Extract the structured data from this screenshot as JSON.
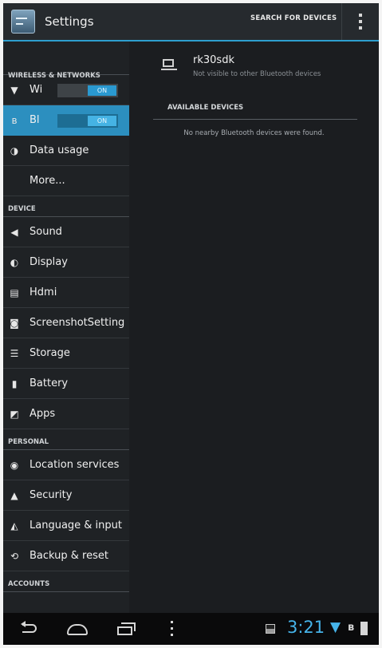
{
  "action_bar": {
    "title": "Settings",
    "search_label": "SEARCH FOR DEVICES"
  },
  "sidebar": {
    "sections": [
      "WIRELESS & NETWORKS",
      "DEVICE",
      "PERSONAL",
      "ACCOUNTS"
    ],
    "wifi": {
      "label": "Wi",
      "toggle": "ON",
      "icon": "wifi-icon"
    },
    "bluetooth": {
      "label": "Bl",
      "toggle": "ON",
      "icon": "bluetooth-icon"
    },
    "items": [
      {
        "label": "Data usage",
        "icon": "data-usage-icon"
      },
      {
        "label": "More...",
        "icon": ""
      },
      {
        "label": "Sound",
        "icon": "speaker-icon"
      },
      {
        "label": "Display",
        "icon": "display-icon"
      },
      {
        "label": "Hdmi",
        "icon": "hdmi-icon"
      },
      {
        "label": "ScreenshotSetting",
        "icon": "camera-icon"
      },
      {
        "label": "Storage",
        "icon": "storage-icon"
      },
      {
        "label": "Battery",
        "icon": "battery-icon"
      },
      {
        "label": "Apps",
        "icon": "apps-icon"
      },
      {
        "label": "Location services",
        "icon": "location-icon"
      },
      {
        "label": "Security",
        "icon": "lock-icon"
      },
      {
        "label": "Language & input",
        "icon": "keyboard-icon"
      },
      {
        "label": "Backup & reset",
        "icon": "backup-icon"
      }
    ]
  },
  "content": {
    "device_name": "rk30sdk",
    "device_status": "Not visible to other Bluetooth devices",
    "available_header": "AVAILABLE DEVICES",
    "empty_message": "No nearby Bluetooth devices were found."
  },
  "status_bar": {
    "time": "3:21"
  },
  "colors": {
    "accent": "#2c8fbf",
    "clock": "#46b4ea",
    "background": "#1b1d20"
  }
}
